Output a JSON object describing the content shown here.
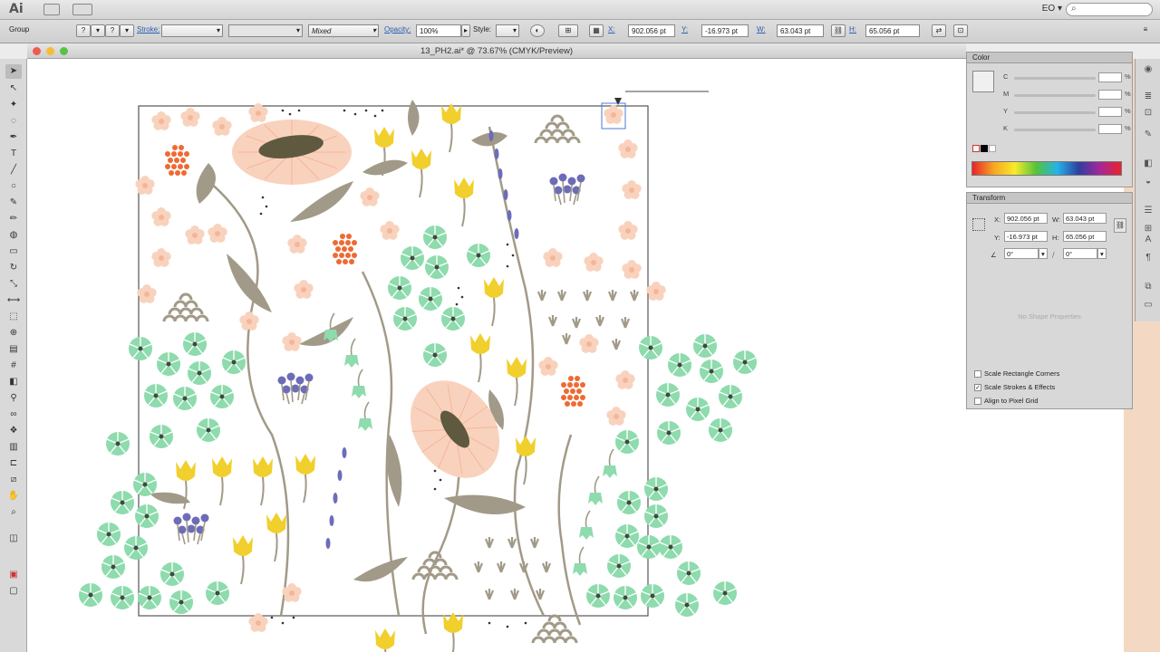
{
  "menubar": {
    "app_logo": "Ai",
    "workspace": "EO",
    "search_glyph": "⌕"
  },
  "controlbar": {
    "selection_type": "Group",
    "stroke_label": "Stroke:",
    "brush_value": "Mixed",
    "opacity_label": "Opacity:",
    "opacity_value": "100%",
    "style_label": "Style:",
    "x_label": "X:",
    "x_value": "902.056 pt",
    "y_label": "Y:",
    "y_value": "-16.973 pt",
    "w_label": "W:",
    "w_value": "63.043 pt",
    "h_label": "H:",
    "h_value": "65.056 pt"
  },
  "document": {
    "title": "13_PH2.ai* @ 73.67% (CMYK/Preview)"
  },
  "color_panel": {
    "tab_label": "Color",
    "channels": [
      "C",
      "M",
      "Y",
      "K"
    ],
    "percent": "%"
  },
  "transform_panel": {
    "tab_label": "Transform",
    "x_label": "X:",
    "x_value": "902.056 pt",
    "y_label": "Y:",
    "y_value": "-16.973 pt",
    "w_label": "W:",
    "w_value": "63.043 pt",
    "h_label": "H:",
    "h_value": "65.056 pt",
    "rotate_value": "0°",
    "shear_value": "0°",
    "no_shape": "No Shape Properties",
    "options": [
      {
        "label": "Scale Rectangle Corners",
        "checked": false
      },
      {
        "label": "Scale Strokes & Effects",
        "checked": true
      },
      {
        "label": "Align to Pixel Grid",
        "checked": false
      }
    ]
  },
  "colors": {
    "peach": "#f9d2bd",
    "orange": "#ee6a32",
    "yellow": "#f1cf2c",
    "green": "#8edbad",
    "purple": "#6c6cb8",
    "taupe": "#a29a88",
    "olive": "#5f5a3f"
  }
}
